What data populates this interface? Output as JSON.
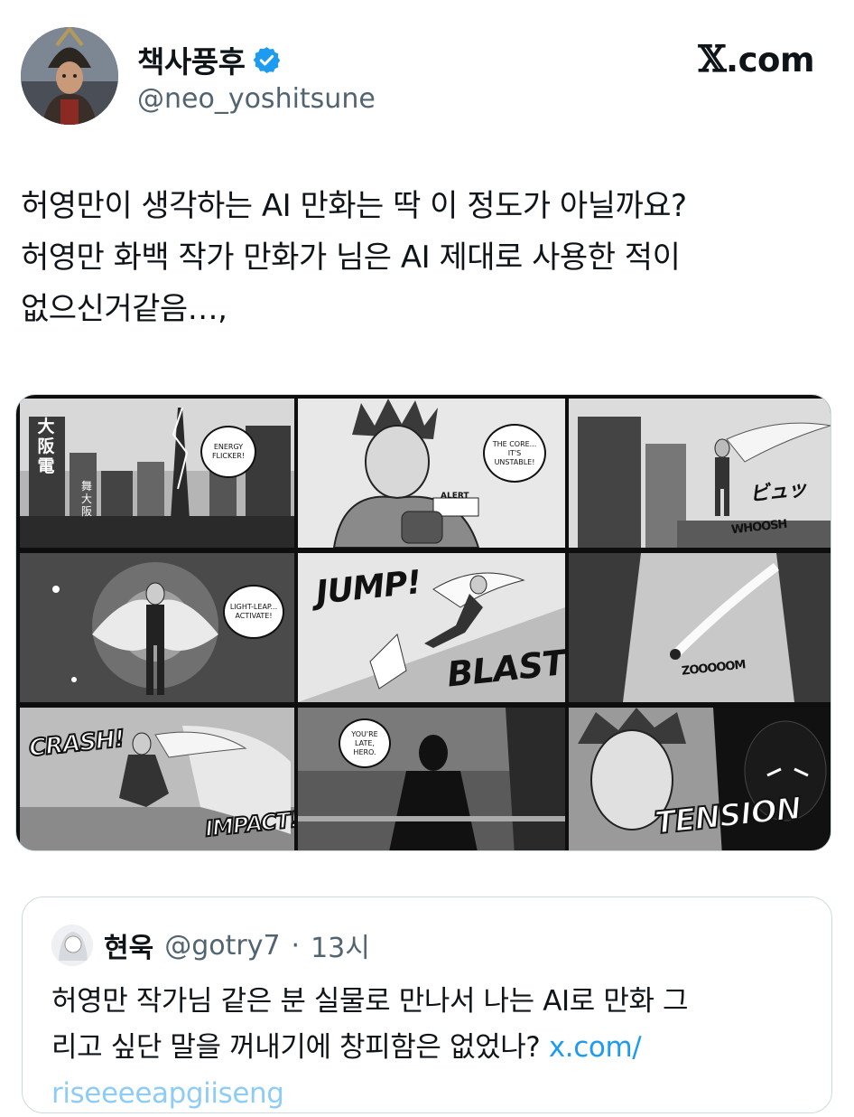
{
  "author": {
    "name": "책사풍후",
    "handle": "@neo_yoshitsune",
    "verified": true,
    "avatar_icon": "samurai-avatar"
  },
  "site_logo": {
    "mark": "𝕏",
    "text": ".com"
  },
  "tweet": {
    "lines": [
      "허영만이 생각하는 AI 만화는 딱 이 정도가 아닐까요?",
      "허영만 화백 작가 만화가 님은 AI 제대로 사용한 적이",
      "없으신거같음…,"
    ]
  },
  "comic": {
    "panels": [
      {
        "text": [
          "ENERGY FLICKER!",
          "大阪電",
          "舞大阪"
        ]
      },
      {
        "text": [
          "THE CORE... IT'S UNSTABLE!",
          "ALERT"
        ]
      },
      {
        "text": [
          "ビュッ",
          "WHOOSH"
        ]
      },
      {
        "text": [
          "LIGHT-LEAP... ACTIVATE!"
        ]
      },
      {
        "text": [
          "JUMP!",
          "BLAST!"
        ]
      },
      {
        "text": [
          "ZOOOOOM"
        ]
      },
      {
        "text": [
          "CRASH!",
          "IMPACT!"
        ]
      },
      {
        "text": [
          "YOU'RE LATE, HERO."
        ]
      },
      {
        "text": [
          "TENSION"
        ]
      }
    ]
  },
  "quote": {
    "name": "현욱",
    "handle": "@gotry7",
    "separator": "·",
    "time": "13시",
    "lines": [
      "허영만 작가님 같은 분 실물로 만나서 나는 AI로 만화 그",
      "리고 싶단 말을 꺼내기에 창피함은 없었나?"
    ],
    "link": "x.com/",
    "link_cut": "riseeeeapgiiseng"
  },
  "colors": {
    "text": "#0f1419",
    "secondary": "#536471",
    "verified_blue": "#1d9bf0",
    "link": "#1d9bf0",
    "border": "#cfd9de"
  }
}
